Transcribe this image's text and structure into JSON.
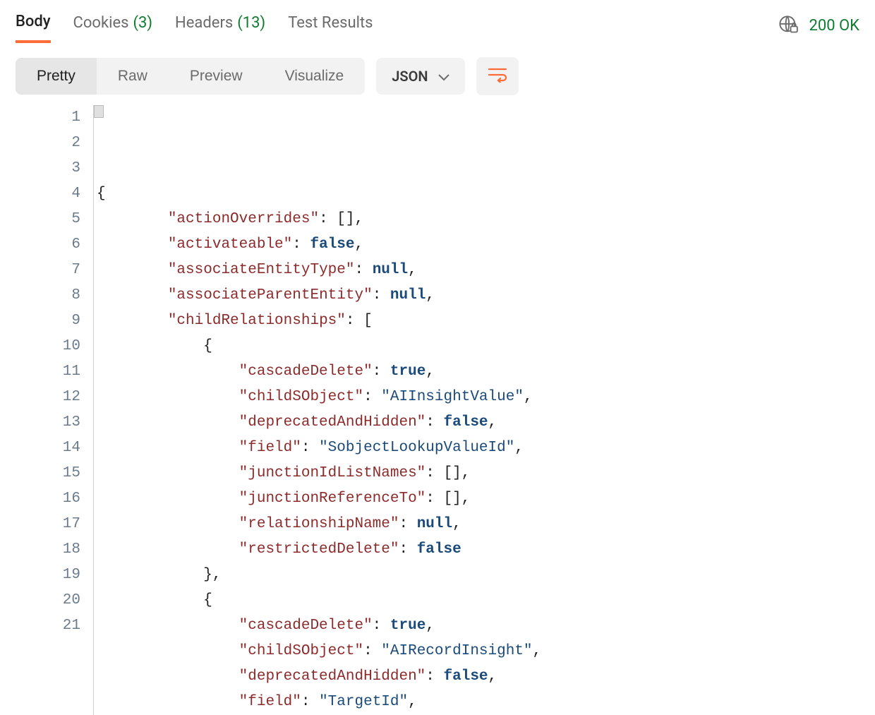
{
  "tabs": {
    "body": "Body",
    "cookies_label": "Cookies",
    "cookies_count": "(3)",
    "headers_label": "Headers",
    "headers_count": "(13)",
    "test_results": "Test Results"
  },
  "status": {
    "code": "200 OK"
  },
  "view_modes": {
    "pretty": "Pretty",
    "raw": "Raw",
    "preview": "Preview",
    "visualize": "Visualize"
  },
  "format_select": {
    "value": "JSON"
  },
  "code_lines": [
    {
      "n": 1,
      "indent": 0,
      "tokens": [
        [
          "punc",
          "{"
        ]
      ]
    },
    {
      "n": 2,
      "indent": 1,
      "tokens": [
        [
          "key",
          "\"actionOverrides\""
        ],
        [
          "punc",
          ": [],"
        ]
      ]
    },
    {
      "n": 3,
      "indent": 1,
      "tokens": [
        [
          "key",
          "\"activateable\""
        ],
        [
          "punc",
          ": "
        ],
        [
          "kw",
          "false"
        ],
        [
          "punc",
          ","
        ]
      ]
    },
    {
      "n": 4,
      "indent": 1,
      "tokens": [
        [
          "key",
          "\"associateEntityType\""
        ],
        [
          "punc",
          ": "
        ],
        [
          "kw",
          "null"
        ],
        [
          "punc",
          ","
        ]
      ]
    },
    {
      "n": 5,
      "indent": 1,
      "tokens": [
        [
          "key",
          "\"associateParentEntity\""
        ],
        [
          "punc",
          ": "
        ],
        [
          "kw",
          "null"
        ],
        [
          "punc",
          ","
        ]
      ]
    },
    {
      "n": 6,
      "indent": 1,
      "tokens": [
        [
          "key",
          "\"childRelationships\""
        ],
        [
          "punc",
          ": ["
        ]
      ]
    },
    {
      "n": 7,
      "indent": 2,
      "tokens": [
        [
          "punc",
          "{"
        ]
      ]
    },
    {
      "n": 8,
      "indent": 3,
      "tokens": [
        [
          "key",
          "\"cascadeDelete\""
        ],
        [
          "punc",
          ": "
        ],
        [
          "kw",
          "true"
        ],
        [
          "punc",
          ","
        ]
      ]
    },
    {
      "n": 9,
      "indent": 3,
      "tokens": [
        [
          "key",
          "\"childSObject\""
        ],
        [
          "punc",
          ": "
        ],
        [
          "str",
          "\"AIInsightValue\""
        ],
        [
          "punc",
          ","
        ]
      ]
    },
    {
      "n": 10,
      "indent": 3,
      "tokens": [
        [
          "key",
          "\"deprecatedAndHidden\""
        ],
        [
          "punc",
          ": "
        ],
        [
          "kw",
          "false"
        ],
        [
          "punc",
          ","
        ]
      ]
    },
    {
      "n": 11,
      "indent": 3,
      "tokens": [
        [
          "key",
          "\"field\""
        ],
        [
          "punc",
          ": "
        ],
        [
          "str",
          "\"SobjectLookupValueId\""
        ],
        [
          "punc",
          ","
        ]
      ]
    },
    {
      "n": 12,
      "indent": 3,
      "tokens": [
        [
          "key",
          "\"junctionIdListNames\""
        ],
        [
          "punc",
          ": [],"
        ]
      ]
    },
    {
      "n": 13,
      "indent": 3,
      "tokens": [
        [
          "key",
          "\"junctionReferenceTo\""
        ],
        [
          "punc",
          ": [],"
        ]
      ]
    },
    {
      "n": 14,
      "indent": 3,
      "tokens": [
        [
          "key",
          "\"relationshipName\""
        ],
        [
          "punc",
          ": "
        ],
        [
          "kw",
          "null"
        ],
        [
          "punc",
          ","
        ]
      ]
    },
    {
      "n": 15,
      "indent": 3,
      "tokens": [
        [
          "key",
          "\"restrictedDelete\""
        ],
        [
          "punc",
          ": "
        ],
        [
          "kw",
          "false"
        ]
      ]
    },
    {
      "n": 16,
      "indent": 2,
      "tokens": [
        [
          "punc",
          "},"
        ]
      ]
    },
    {
      "n": 17,
      "indent": 2,
      "tokens": [
        [
          "punc",
          "{"
        ]
      ]
    },
    {
      "n": 18,
      "indent": 3,
      "tokens": [
        [
          "key",
          "\"cascadeDelete\""
        ],
        [
          "punc",
          ": "
        ],
        [
          "kw",
          "true"
        ],
        [
          "punc",
          ","
        ]
      ]
    },
    {
      "n": 19,
      "indent": 3,
      "tokens": [
        [
          "key",
          "\"childSObject\""
        ],
        [
          "punc",
          ": "
        ],
        [
          "str",
          "\"AIRecordInsight\""
        ],
        [
          "punc",
          ","
        ]
      ]
    },
    {
      "n": 20,
      "indent": 3,
      "tokens": [
        [
          "key",
          "\"deprecatedAndHidden\""
        ],
        [
          "punc",
          ": "
        ],
        [
          "kw",
          "false"
        ],
        [
          "punc",
          ","
        ]
      ]
    },
    {
      "n": 21,
      "indent": 3,
      "tokens": [
        [
          "key",
          "\"field\""
        ],
        [
          "punc",
          ": "
        ],
        [
          "str",
          "\"TargetId\""
        ],
        [
          "punc",
          ","
        ]
      ]
    }
  ]
}
